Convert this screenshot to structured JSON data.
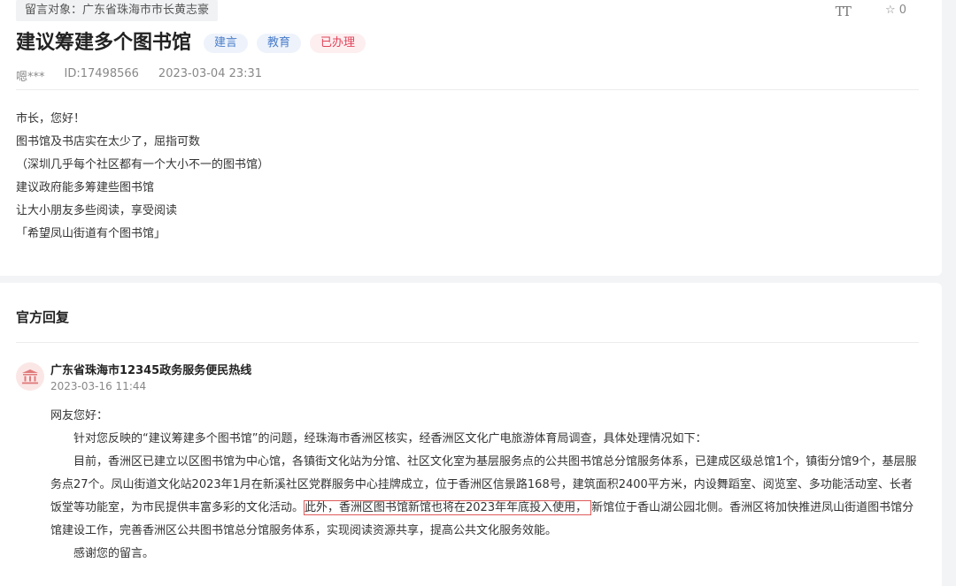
{
  "message": {
    "target_label": "留言对象：广东省珠海市市长黄志豪",
    "font_size_icon": "text-size-icon",
    "star_count": "☆ 0",
    "title": "建议筹建多个图书馆",
    "tags": [
      "建言",
      "教育",
      "已办理"
    ],
    "author": "嗯***",
    "id": "ID:17498566",
    "time": "2023-03-04 23:31",
    "lines": [
      "市长，您好！",
      "图书馆及书店实在太少了，屈指可数",
      "（深圳几乎每个社区都有一个大小不一的图书馆）",
      "建议政府能多筹建些图书馆",
      "让大小朋友多些阅读，享受阅读",
      "「希望凤山街道有个图书馆」"
    ]
  },
  "reply": {
    "section_title": "官方回复",
    "org": "广东省珠海市12345政务服务便民热线",
    "date": "2023-03-16 11:44",
    "greeting": "网友您好：",
    "p1": "针对您反映的“建议筹建多个图书馆”的问题，经珠海市香洲区核实，经香洲区文化广电旅游体育局调查，具体处理情况如下：",
    "p2_a": "目前，香洲区已建立以区图书馆为中心馆，各镇街文化站为分馆、社区文化室为基层服务点的公共图书馆总分馆服务体系，已建成区级总馆1个，镇街分馆9个，基层服务点27个。凤山街道文化站2023年1月在新溪社区党群服务中心挂牌成立，位于香洲区信景路168号，建筑面积2400平方米，内设舞蹈室、阅览室、多功能活动室、长者饭堂等功能室，为市民提供丰富多彩的文化活动。",
    "p2_highlight": "此外，香洲区图书馆新馆也将在2023年年底投入使用，",
    "p2_b": "新馆位于香山湖公园北侧。香洲区将加快推进凤山街道图书馆分馆建设工作，完善香洲区公共图书馆总分馆服务体系，实现阅读资源共享，提高公共文化服务效能。",
    "closing": "感谢您的留言。"
  }
}
